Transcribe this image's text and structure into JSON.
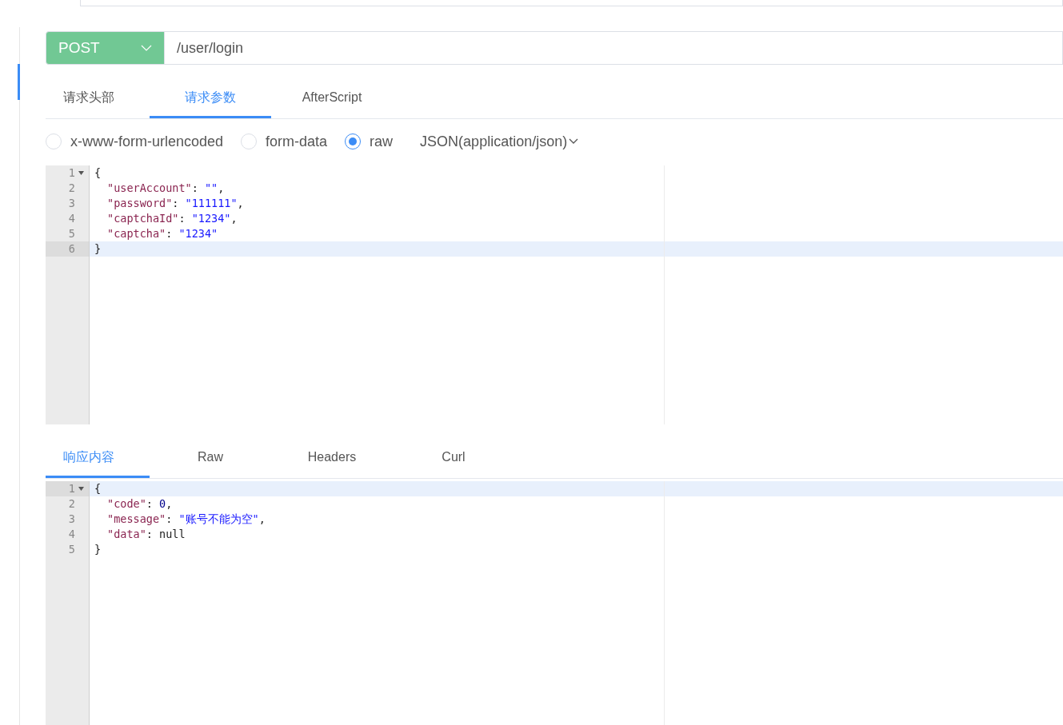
{
  "request": {
    "method": "POST",
    "url": "/user/login"
  },
  "request_tabs": [
    {
      "label": "请求头部",
      "selected": false
    },
    {
      "label": "请求参数",
      "selected": true
    },
    {
      "label": "AfterScript",
      "selected": false
    }
  ],
  "body_types": [
    {
      "label": "x-www-form-urlencoded",
      "selected": false
    },
    {
      "label": "form-data",
      "selected": false
    },
    {
      "label": "raw",
      "selected": true
    }
  ],
  "content_type": "JSON(application/json)",
  "request_editor": {
    "lines": [
      {
        "number": "1",
        "fold": true,
        "active": false,
        "indent": false,
        "tokens": [
          {
            "kind": "punct",
            "text": "{"
          }
        ]
      },
      {
        "number": "2",
        "fold": false,
        "active": false,
        "indent": true,
        "tokens": [
          {
            "kind": "key",
            "text": "\"userAccount\""
          },
          {
            "kind": "punct",
            "text": ": "
          },
          {
            "kind": "str",
            "text": "\"\""
          },
          {
            "kind": "punct",
            "text": ","
          }
        ]
      },
      {
        "number": "3",
        "fold": false,
        "active": false,
        "indent": true,
        "tokens": [
          {
            "kind": "key",
            "text": "\"password\""
          },
          {
            "kind": "punct",
            "text": ": "
          },
          {
            "kind": "str",
            "text": "\"111111\""
          },
          {
            "kind": "punct",
            "text": ","
          }
        ]
      },
      {
        "number": "4",
        "fold": false,
        "active": false,
        "indent": true,
        "tokens": [
          {
            "kind": "key",
            "text": "\"captchaId\""
          },
          {
            "kind": "punct",
            "text": ": "
          },
          {
            "kind": "str",
            "text": "\"1234\""
          },
          {
            "kind": "punct",
            "text": ","
          }
        ]
      },
      {
        "number": "5",
        "fold": false,
        "active": false,
        "indent": true,
        "tokens": [
          {
            "kind": "key",
            "text": "\"captcha\""
          },
          {
            "kind": "punct",
            "text": ": "
          },
          {
            "kind": "str",
            "text": "\"1234\""
          }
        ]
      },
      {
        "number": "6",
        "fold": false,
        "active": true,
        "indent": false,
        "tokens": [
          {
            "kind": "punct",
            "text": "}"
          }
        ]
      }
    ]
  },
  "response_tabs": [
    {
      "label": "响应内容",
      "selected": true
    },
    {
      "label": "Raw",
      "selected": false
    },
    {
      "label": "Headers",
      "selected": false
    },
    {
      "label": "Curl",
      "selected": false
    }
  ],
  "response_editor": {
    "lines": [
      {
        "number": "1",
        "fold": true,
        "active": true,
        "indent": false,
        "tokens": [
          {
            "kind": "punct",
            "text": "{"
          }
        ]
      },
      {
        "number": "2",
        "fold": false,
        "active": false,
        "indent": true,
        "tokens": [
          {
            "kind": "key",
            "text": "\"code\""
          },
          {
            "kind": "punct",
            "text": ": "
          },
          {
            "kind": "num",
            "text": "0"
          },
          {
            "kind": "punct",
            "text": ","
          }
        ]
      },
      {
        "number": "3",
        "fold": false,
        "active": false,
        "indent": true,
        "tokens": [
          {
            "kind": "key",
            "text": "\"message\""
          },
          {
            "kind": "punct",
            "text": ": "
          },
          {
            "kind": "str",
            "text": "\"账号不能为空\""
          },
          {
            "kind": "punct",
            "text": ","
          }
        ]
      },
      {
        "number": "4",
        "fold": false,
        "active": false,
        "indent": true,
        "tokens": [
          {
            "kind": "key",
            "text": "\"data\""
          },
          {
            "kind": "punct",
            "text": ": "
          },
          {
            "kind": "punct",
            "text": "null"
          }
        ]
      },
      {
        "number": "5",
        "fold": false,
        "active": false,
        "indent": false,
        "tokens": [
          {
            "kind": "punct",
            "text": "}"
          }
        ]
      }
    ]
  }
}
